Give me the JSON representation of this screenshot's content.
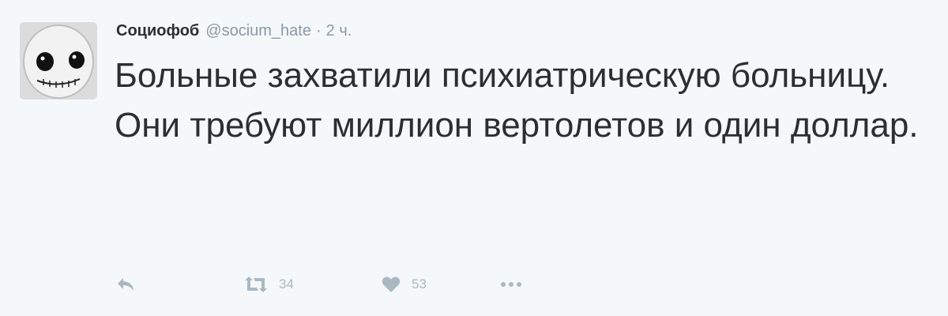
{
  "tweet": {
    "author": {
      "display_name": "Социофоб",
      "username": "@socium_hate",
      "separator": "·",
      "timestamp": "2 ч."
    },
    "text_lines": [
      "Больные захватили психиатрическую больницу.",
      "Они требуют миллион вертолетов и один доллар."
    ],
    "actions": {
      "reply_icon": "reply-icon",
      "retweet_icon": "retweet-icon",
      "retweet_count": "34",
      "like_icon": "heart-icon",
      "like_count": "53",
      "more_icon": "more-dots-icon"
    },
    "colors": {
      "background": "#f5f8fa",
      "text": "#292f33",
      "muted": "#8899a6",
      "action": "#aab8c2"
    }
  }
}
